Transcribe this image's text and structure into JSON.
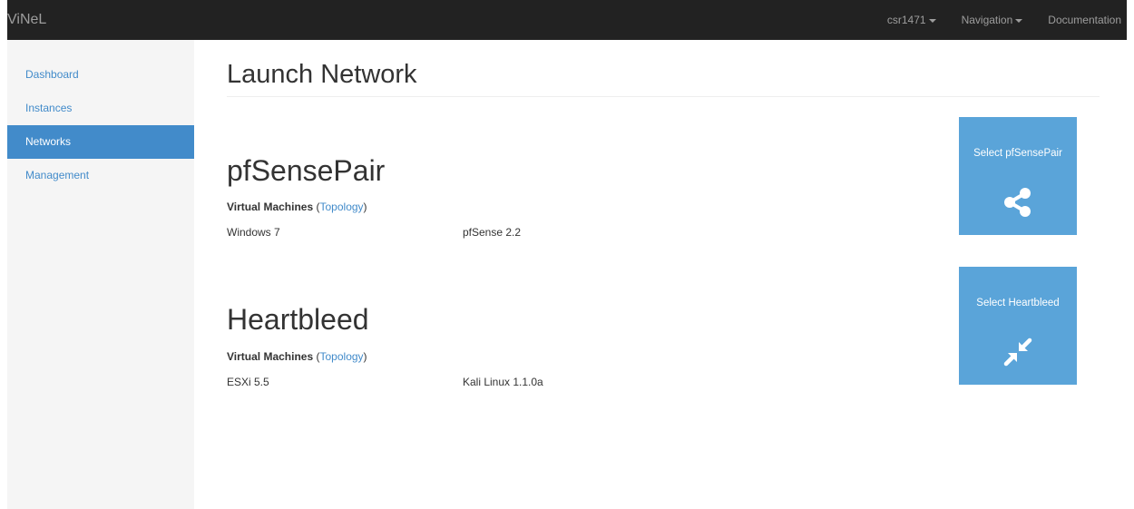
{
  "navbar": {
    "brand": "ViNeL",
    "user_label": "csr1471",
    "navigation_label": "Navigation",
    "documentation_label": "Documentation"
  },
  "sidebar": {
    "items": [
      {
        "label": "Dashboard"
      },
      {
        "label": "Instances"
      },
      {
        "label": "Networks"
      },
      {
        "label": "Management"
      }
    ],
    "active": "Networks"
  },
  "page": {
    "title": "Launch Network"
  },
  "networks": [
    {
      "name": "pfSensePair",
      "vm_heading": "Virtual Machines",
      "topology_link": "Topology",
      "vms": [
        "Windows 7",
        "pfSense 2.2"
      ],
      "select_label": "Select pfSensePair",
      "icon": "share-icon"
    },
    {
      "name": "Heartbleed",
      "vm_heading": "Virtual Machines",
      "topology_link": "Topology",
      "vms": [
        "ESXi 5.5",
        "Kali Linux 1.1.0a"
      ],
      "select_label": "Select Heartbleed",
      "icon": "compress-icon"
    }
  ],
  "colors": {
    "navbar_bg": "#222222",
    "navbar_text": "#9d9d9d",
    "sidebar_bg": "#f5f5f5",
    "link": "#428bca",
    "tile_bg": "#5aa4d9"
  }
}
